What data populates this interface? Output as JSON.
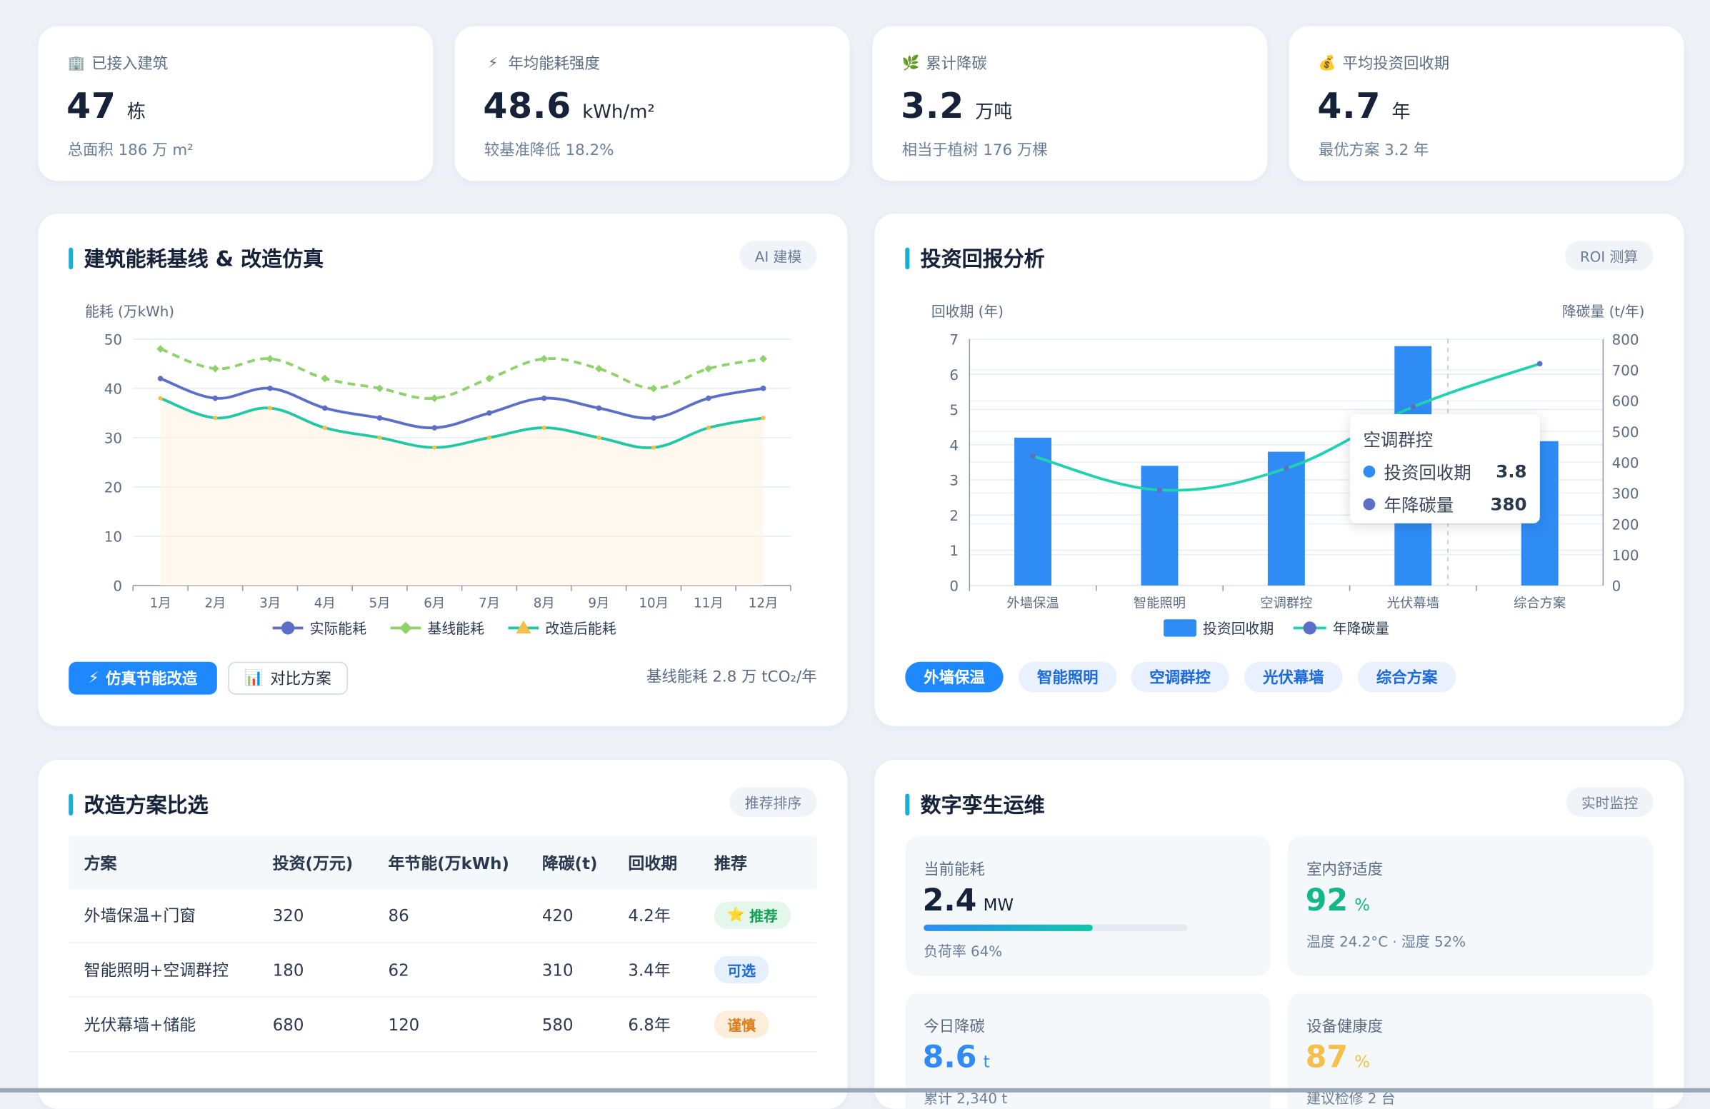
{
  "kpis": [
    {
      "icon": "building-icon",
      "glyph": "🏢",
      "label": "已接入建筑",
      "value": "47",
      "unit": "栋",
      "sub": "总面积 186 万 m²"
    },
    {
      "icon": "lightning-icon",
      "glyph": "⚡",
      "label": "年均能耗强度",
      "value": "48.6",
      "unit": "kWh/m²",
      "sub": "较基准降低 18.2%"
    },
    {
      "icon": "leaf-icon",
      "glyph": "🌿",
      "label": "累计降碳",
      "value": "3.2",
      "unit": "万吨",
      "sub": "相当于植树 176 万棵"
    },
    {
      "icon": "money-bag-icon",
      "glyph": "💰",
      "label": "平均投资回收期",
      "value": "4.7",
      "unit": "年",
      "sub": "最优方案 3.2 年"
    }
  ],
  "energy_panel": {
    "title": "建筑能耗基线 & 改造仿真",
    "tag": "AI 建模",
    "simulate_btn": "仿真节能改造",
    "compare_btn": "对比方案",
    "footnote": "基线能耗 2.8 万 tCO₂/年"
  },
  "roi_panel": {
    "title": "投资回报分析",
    "tag": "ROI 测算",
    "options": [
      "外墙保温",
      "智能照明",
      "空调群控",
      "光伏幕墙",
      "综合方案"
    ],
    "active_option": "外墙保温",
    "tooltip": {
      "title": "空调群控",
      "rows": [
        {
          "name": "投资回收期",
          "value": "3.8",
          "color": "#2f8cf5"
        },
        {
          "name": "年降碳量",
          "value": "380",
          "color": "#5b6fc8"
        }
      ]
    }
  },
  "scheme_panel": {
    "title": "改造方案比选",
    "tag": "推荐排序",
    "columns": [
      "方案",
      "投资(万元)",
      "年节能(万kWh)",
      "降碳(t)",
      "回收期",
      "推荐"
    ],
    "rows": [
      {
        "name": "外墙保温+门窗",
        "invest": "320",
        "saving": "86",
        "carbon": "420",
        "payback": "4.2年",
        "badge": "推荐",
        "badge_style": "green",
        "badge_icon": "⭐"
      },
      {
        "name": "智能照明+空调群控",
        "invest": "180",
        "saving": "62",
        "carbon": "310",
        "payback": "3.4年",
        "badge": "可选",
        "badge_style": "blue",
        "badge_icon": ""
      },
      {
        "name": "光伏幕墙+储能",
        "invest": "680",
        "saving": "120",
        "carbon": "580",
        "payback": "6.8年",
        "badge": "谨慎",
        "badge_style": "orange",
        "badge_icon": ""
      }
    ]
  },
  "twin_panel": {
    "title": "数字孪生运维",
    "tag": "实时监控",
    "tiles": [
      {
        "label": "当前能耗",
        "value": "2.4",
        "unit": "MW",
        "sub": "负荷率 64%",
        "color": "#16213a",
        "progress": 0.64
      },
      {
        "label": "室内舒适度",
        "value": "92",
        "unit": "%",
        "sub": "温度 24.2°C · 湿度 52%",
        "color": "#12b886"
      },
      {
        "label": "今日降碳",
        "value": "8.6",
        "unit": "t",
        "sub": "累计 2,340 t",
        "color": "#2f8cf5"
      },
      {
        "label": "设备健康度",
        "value": "87",
        "unit": "%",
        "sub": "建议检修 2 台",
        "color": "#f5c04a"
      }
    ]
  },
  "chart_data": [
    {
      "type": "line",
      "title": "",
      "ylabel": "能耗 (万kWh)",
      "ylim": [
        0,
        50
      ],
      "yticks": [
        0,
        10,
        20,
        30,
        40,
        50
      ],
      "categories": [
        "1月",
        "2月",
        "3月",
        "4月",
        "5月",
        "6月",
        "7月",
        "8月",
        "9月",
        "10月",
        "11月",
        "12月"
      ],
      "series": [
        {
          "name": "实际能耗",
          "values": [
            42,
            38,
            40,
            36,
            34,
            32,
            35,
            38,
            36,
            34,
            38,
            40
          ],
          "color": "#5b6fc8",
          "style": "solid"
        },
        {
          "name": "基线能耗",
          "values": [
            48,
            44,
            46,
            42,
            40,
            38,
            42,
            46,
            44,
            40,
            44,
            46
          ],
          "color": "#8fd16a",
          "style": "dashed"
        },
        {
          "name": "改造后能耗",
          "values": [
            38,
            34,
            36,
            32,
            30,
            28,
            30,
            32,
            30,
            28,
            32,
            34
          ],
          "color": "#22c7a5",
          "style": "solid",
          "area": true
        }
      ],
      "legend": "bottom",
      "grid": true
    },
    {
      "type": "bar",
      "ylabel": "回收期 (年)",
      "y2label": "降碳量 (t/年)",
      "ylim": [
        0,
        7
      ],
      "y2lim": [
        0,
        800
      ],
      "yticks": [
        0,
        1,
        2,
        3,
        4,
        5,
        6,
        7
      ],
      "y2ticks": [
        0,
        100,
        200,
        300,
        400,
        500,
        600,
        700,
        800
      ],
      "categories": [
        "外墙保温",
        "智能照明",
        "空调群控",
        "光伏幕墙",
        "综合方案"
      ],
      "series": [
        {
          "name": "投资回收期",
          "type": "bar",
          "axis": "left",
          "values": [
            4.2,
            3.4,
            3.8,
            6.8,
            4.1
          ],
          "color": "#2f8cf5"
        },
        {
          "name": "年降碳量",
          "type": "line",
          "axis": "right",
          "values": [
            420,
            310,
            380,
            580,
            720
          ],
          "color": "#1fd3b0",
          "marker_color": "#5b6fc8"
        }
      ],
      "highlight_category": "光伏幕墙",
      "legend": "bottom",
      "grid": true
    }
  ]
}
